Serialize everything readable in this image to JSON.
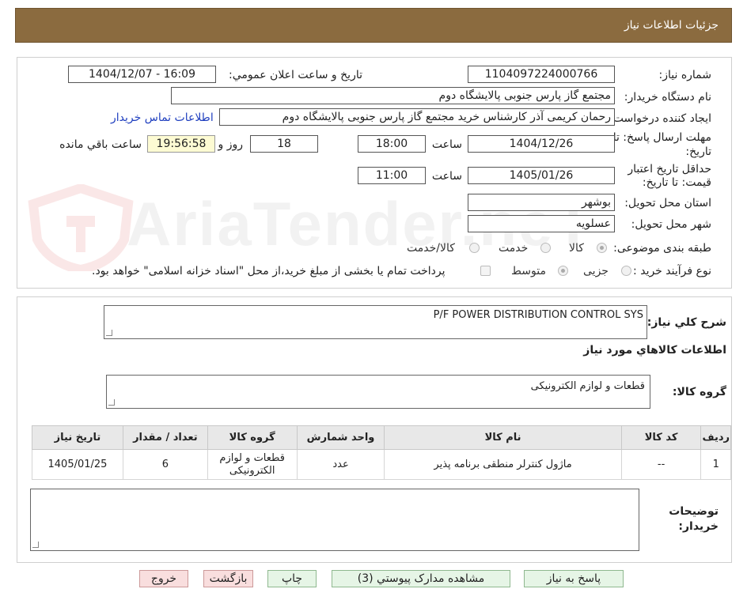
{
  "header": {
    "title": "جزئیات اطلاعات نیاز"
  },
  "form": {
    "need_number_label": "شماره نیاز:",
    "need_number": "1104097224000766",
    "announce_label": "تاریخ و ساعت اعلان عمومي:",
    "announce_value": "1404/12/07 - 16:09",
    "buyer_org_label": "نام دستگاه خریدار:",
    "buyer_org": "مجتمع گاز پارس جنوبی  پالایشگاه دوم",
    "requester_label": "ایجاد کننده درخواست:",
    "requester": "رحمان کریمی آذر کارشناس خرید مجتمع گاز پارس جنوبی  پالایشگاه دوم",
    "contact_link": "اطلاعات تماس خریدار",
    "reply_deadline_label_1": "مهلت ارسال پاسخ: تا",
    "reply_deadline_label_2": "تاریخ:",
    "reply_date": "1404/12/26",
    "time_label": "ساعت",
    "reply_time": "18:00",
    "days": "18",
    "days_label": "روز و",
    "remaining": "19:56:58",
    "remaining_label": "ساعت باقي مانده",
    "validity_label_1": "حداقل تاریخ اعتبار",
    "validity_label_2": "قیمت: تا تاریخ:",
    "validity_date": "1405/01/26",
    "validity_time": "11:00",
    "province_label": "استان محل تحویل:",
    "province": "بوشهر",
    "city_label": "شهر محل تحویل:",
    "city": "عسلویه",
    "category_label": "طبقه بندی موضوعی:",
    "category_options": [
      "کالا",
      "خدمت",
      "کالا/خدمت"
    ],
    "process_label": "نوع فرآیند خرید :",
    "process_options": [
      "جزیی",
      "متوسط"
    ],
    "payment_note": "پرداخت تمام یا بخشی از مبلغ خرید،از محل \"اسناد خزانه اسلامی\" خواهد بود."
  },
  "watermark": {
    "text": "AriaTender.neT"
  },
  "summary": {
    "label": "شرح کلي نیاز:",
    "value": "P/F POWER DISTRIBUTION CONTROL SYS"
  },
  "goods_info": {
    "title": "اطلاعات کالاهاي مورد نیاز",
    "group_label": "گروه کالا:",
    "group_value": "قطعات و لوازم الکترونیکی"
  },
  "table": {
    "headers": [
      "ردیف",
      "کد کالا",
      "نام کالا",
      "واحد شمارش",
      "گروه کالا",
      "تعداد / مقدار",
      "تاریخ نیاز"
    ],
    "rows": [
      [
        "1",
        "--",
        "ماژول کنترلر منطقی برنامه پذیر",
        "عدد",
        "قطعات و لوازم الکترونیکی",
        "6",
        "1405/01/25"
      ]
    ]
  },
  "notes": {
    "label_1": "توضیحات",
    "label_2": "خریدار:"
  },
  "buttons": {
    "reply": "پاسخ به نیاز",
    "attachments": "مشاهده مدارک پیوستي (3)",
    "print": "چاپ",
    "back": "بازگشت",
    "exit": "خروج"
  },
  "colors": {
    "header_bg": "#8b6b3f",
    "link": "#1f3fbf",
    "remaining_bg": "#fdfbd3",
    "button_green": "#e6f5e6",
    "button_pink": "#f9dede"
  }
}
